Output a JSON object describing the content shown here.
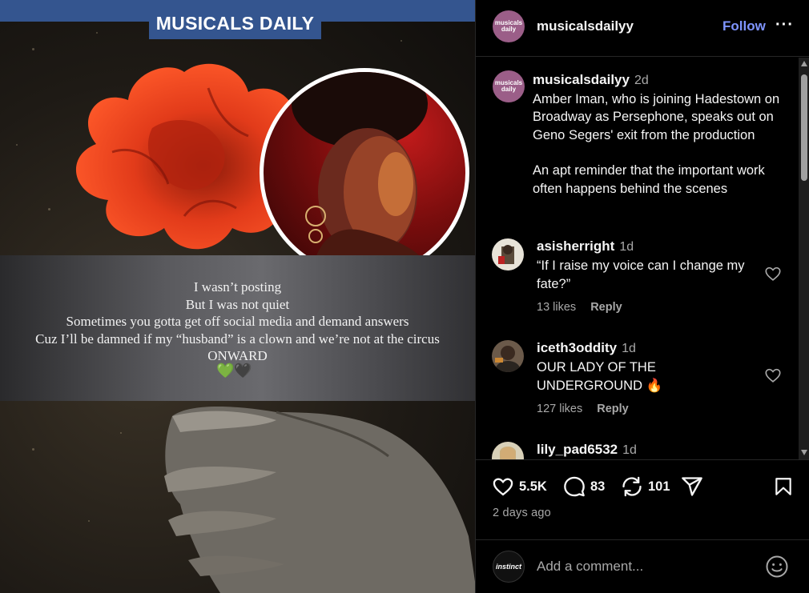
{
  "post": {
    "banner": "MUSICALS DAILY",
    "caption_lines": [
      "I wasn’t posting",
      "But I was not quiet",
      "Sometimes you gotta get off social media and demand answers",
      "Cuz I’ll be damned if my “husband” is a clown and we’re not at the circus",
      "ONWARD"
    ],
    "hearts": "💚🖤"
  },
  "header": {
    "avatar_text_1": "musicals",
    "avatar_text_2": "daily",
    "username": "musicalsdailyy",
    "follow_label": "Follow",
    "more_label": "···"
  },
  "caption": {
    "username": "musicalsdailyy",
    "time": "2d",
    "paragraph_1": "Amber Iman, who is joining Hadestown on Broadway as Persephone, speaks out on Geno Segers' exit from the production",
    "paragraph_2": "An apt reminder that the important work often happens behind the scenes"
  },
  "comments": [
    {
      "username": "asisherright",
      "time": "1d",
      "text": "“If I raise my voice can I change my fate?”",
      "likes": "13 likes",
      "reply": "Reply"
    },
    {
      "username": "iceth3oddity",
      "time": "1d",
      "text": "OUR LADY OF THE UNDERGROUND 🔥",
      "likes": "127 likes",
      "reply": "Reply"
    },
    {
      "username": "lily_pad6532",
      "time": "1d"
    }
  ],
  "actions": {
    "likes": "5.5K",
    "comments": "83",
    "reposts": "101",
    "posted": "2 days ago"
  },
  "composer": {
    "avatar_text": "instinct",
    "placeholder": "Add a comment..."
  },
  "colors": {
    "follow": "#7f95ff",
    "banner": "#34558f",
    "muted": "#a8a8a8"
  }
}
